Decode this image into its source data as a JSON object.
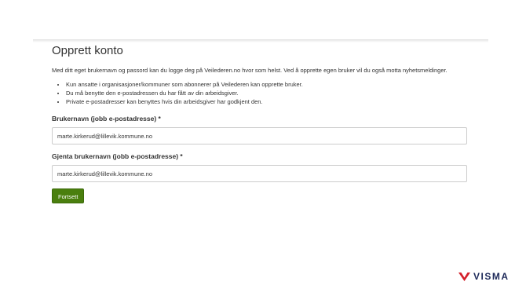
{
  "page": {
    "title": "Opprett konto",
    "intro": "Med ditt eget brukernavn og passord kan du logge deg på Veilederen.no hvor som helst. Ved å opprette egen bruker vil du også motta nyhetsmeldinger.",
    "bullets": [
      "Kun ansatte i organisasjoner/kommuner som abonnerer på Veilederen kan opprette bruker.",
      "Du må benytte den e-postadressen du har fått av din arbeidsgiver.",
      "Private e-postadresser kan benyttes hvis din arbeidsgiver har godkjent den."
    ]
  },
  "form": {
    "username_label": "Brukernavn (jobb e-postadresse) *",
    "username_value": "marte.kirkerud@lillevik.kommune.no",
    "repeat_label": "Gjenta brukernavn (jobb e-postadresse) *",
    "repeat_value": "marte.kirkerud@lillevik.kommune.no",
    "submit_label": "Fortsett"
  },
  "brand": {
    "name": "VISMA",
    "icon": "visma-logo-icon",
    "accent": "#d4202b",
    "text_color": "#1e2a5a",
    "button_color": "#4a7f0e"
  }
}
